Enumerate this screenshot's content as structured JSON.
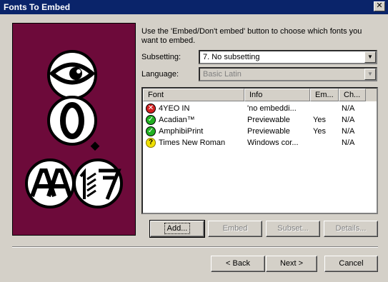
{
  "window": {
    "title": "Fonts To Embed",
    "close_glyph": "✕"
  },
  "instructions": "Use the 'Embed/Don't embed' button to choose which fonts you want to embed.",
  "subsetting": {
    "label": "Subsetting:",
    "value": "7. No subsetting"
  },
  "language": {
    "label": "Language:",
    "value": "Basic Latin"
  },
  "font_list": {
    "columns": [
      "Font",
      "Info",
      "Em...",
      "Ch..."
    ],
    "rows": [
      {
        "status": "error",
        "status_glyph": "✕",
        "font": "4YEO IN",
        "info": "'no embeddi...",
        "embed": "",
        "change": "N/A"
      },
      {
        "status": "ok",
        "status_glyph": "✓",
        "font": "Acadian™",
        "info": "Previewable",
        "embed": "Yes",
        "change": "N/A"
      },
      {
        "status": "ok",
        "status_glyph": "✓",
        "font": "AmphibiPrint",
        "info": "Previewable",
        "embed": "Yes",
        "change": "N/A"
      },
      {
        "status": "warning",
        "status_glyph": "?",
        "font": "Times New Roman",
        "info": "Windows cor...",
        "embed": "",
        "change": "N/A"
      }
    ]
  },
  "buttons": {
    "add": "Add...",
    "embed": "Embed",
    "subset": "Subset...",
    "details": "Details...",
    "back": "< Back",
    "next": "Next >",
    "cancel": "Cancel"
  },
  "colors": {
    "titlebar": "#0a246a",
    "illustration_bg": "#6d0a3a",
    "error": "#d42020",
    "ok": "#22b022",
    "warning": "#f0e000"
  }
}
